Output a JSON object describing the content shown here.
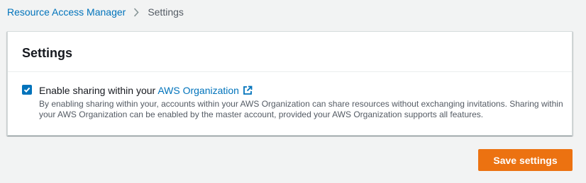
{
  "breadcrumb": {
    "items": [
      {
        "label": "Resource Access Manager",
        "link": true
      },
      {
        "label": "Settings",
        "link": false
      }
    ]
  },
  "panel": {
    "title": "Settings",
    "option": {
      "checked": true,
      "label_prefix": "Enable sharing within your ",
      "link_text": "AWS Organization",
      "description": "By enabling sharing within your, accounts within your AWS Organization can share resources without exchanging invitations. Sharing within your AWS Organization can be enabled by the master account, provided your AWS Organization supports all features."
    }
  },
  "actions": {
    "save_label": "Save settings"
  },
  "colors": {
    "accent_link": "#0073bb",
    "primary_button": "#ec7211",
    "background": "#f2f3f3"
  },
  "icons": {
    "breadcrumb_separator": "chevron-right-icon",
    "checkbox": "checkmark-icon",
    "external_link": "external-link-icon"
  }
}
